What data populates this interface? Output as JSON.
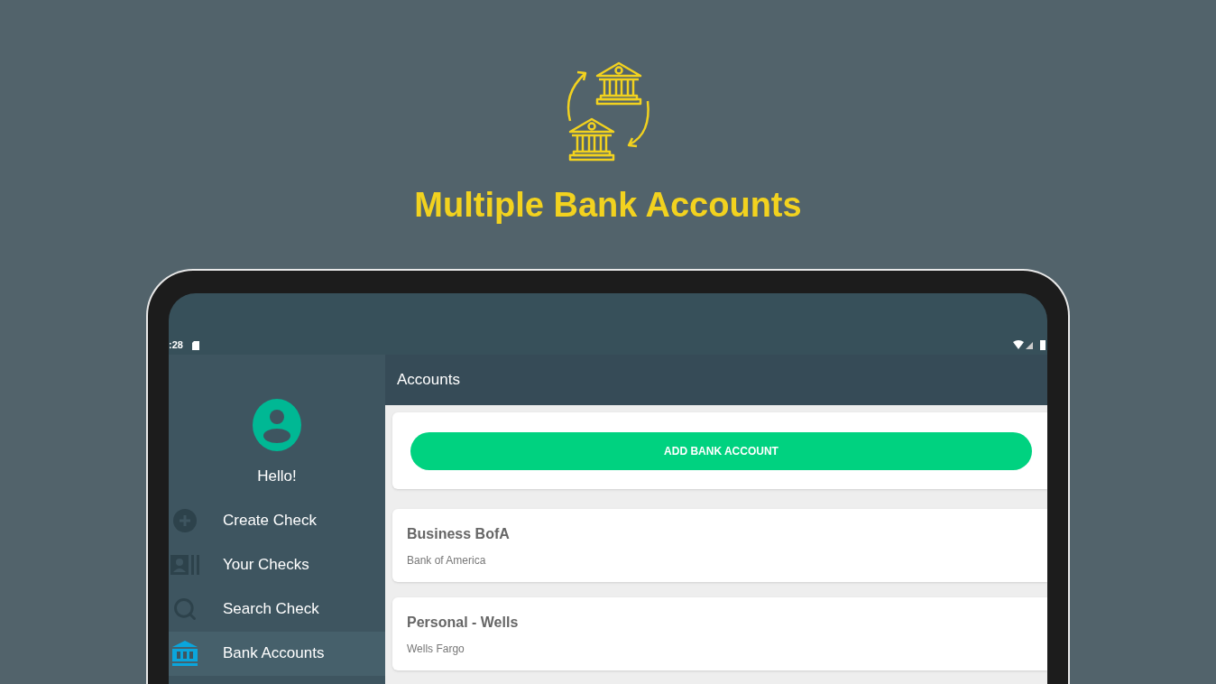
{
  "headline": "Multiple Bank Accounts",
  "status_bar": {
    "time": ":28"
  },
  "drawer": {
    "greeting": "Hello!",
    "items": [
      {
        "label": "Create Check",
        "kind": "create",
        "selected": false
      },
      {
        "label": "Your Checks",
        "kind": "checks",
        "selected": false
      },
      {
        "label": "Search Check",
        "kind": "search",
        "selected": false
      },
      {
        "label": "Bank Accounts",
        "kind": "bank",
        "selected": true
      }
    ]
  },
  "app_bar": {
    "title": "Accounts"
  },
  "add_button": "ADD BANK ACCOUNT",
  "accounts": [
    {
      "name": "Business BofA",
      "bank": "Bank of America"
    },
    {
      "name": "Personal - Wells",
      "bank": "Wells Fargo"
    }
  ]
}
